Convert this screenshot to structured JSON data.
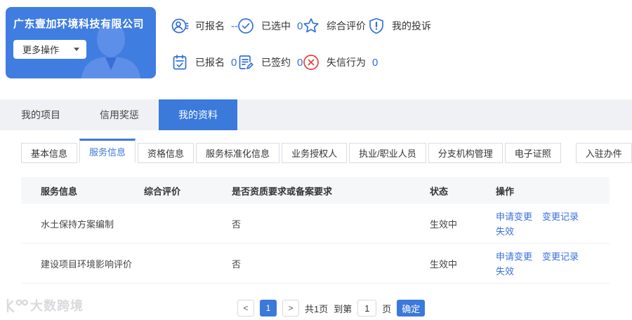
{
  "company_card": {
    "name": "广东壹加环境科技有限公司",
    "more_actions_label": "更多操作"
  },
  "stats": [
    {
      "icon": "user-circle-icon",
      "label": "可报名",
      "value": "--"
    },
    {
      "icon": "check-circle-icon",
      "label": "已选中",
      "value": "0"
    },
    {
      "icon": "star-icon",
      "label": "综合评价",
      "value": ""
    },
    {
      "icon": "shield-exclamation-icon",
      "label": "我的投诉",
      "value": ""
    },
    {
      "icon": "clipboard-check-icon",
      "label": "已报名",
      "value": "0"
    },
    {
      "icon": "document-sign-icon",
      "label": "已签约",
      "value": "0"
    },
    {
      "icon": "x-circle-icon",
      "label": "失信行为",
      "value": "0"
    }
  ],
  "main_tabs": [
    {
      "label": "我的项目",
      "active": false
    },
    {
      "label": "信用奖惩",
      "active": false
    },
    {
      "label": "我的资料",
      "active": true
    }
  ],
  "sub_tabs": [
    {
      "label": "基本信息",
      "active": false
    },
    {
      "label": "服务信息",
      "active": true
    },
    {
      "label": "资格信息",
      "active": false
    },
    {
      "label": "服务标准化信息",
      "active": false
    },
    {
      "label": "业务授权人",
      "active": false
    },
    {
      "label": "执业/职业人员",
      "active": false
    },
    {
      "label": "分支机构管理",
      "active": false
    },
    {
      "label": "电子证照",
      "active": false
    },
    {
      "label": "入驻办件",
      "active": false
    }
  ],
  "table": {
    "headers": [
      "服务信息",
      "综合评价",
      "是否资质要求或备案要求",
      "状态",
      "操作"
    ],
    "rows": [
      {
        "service": "水土保持方案编制",
        "rating": "",
        "requirement": "否",
        "status": "生效中",
        "actions": [
          "申请变更",
          "变更记录",
          "失效"
        ]
      },
      {
        "service": "建设项目环境影响评价",
        "rating": "",
        "requirement": "否",
        "status": "生效中",
        "actions": [
          "申请变更",
          "变更记录",
          "失效"
        ]
      }
    ]
  },
  "pagination": {
    "prev": "<",
    "page": "1",
    "next": ">",
    "total_text": "共1页",
    "goto_prefix": "到第",
    "goto_value": "1",
    "goto_suffix": "页",
    "confirm_label": "确定"
  },
  "watermark": {
    "text": "大数跨境"
  },
  "colors": {
    "primary": "#3b79da",
    "card_blue": "#407de0",
    "link_blue": "#3a70e0",
    "danger_red": "#e2403c"
  }
}
